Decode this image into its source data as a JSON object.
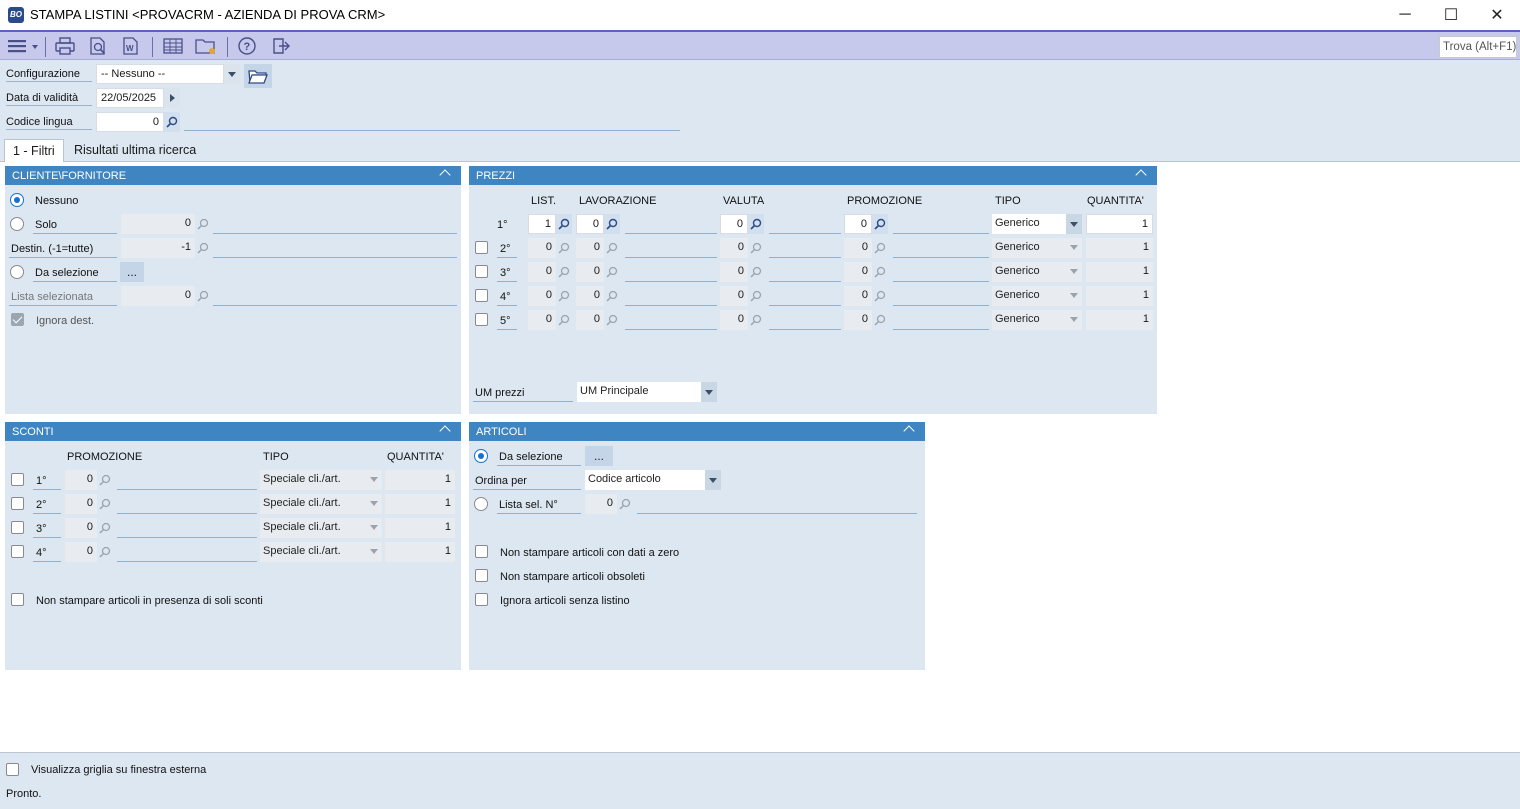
{
  "window": {
    "app_icon": "BO",
    "title": "STAMPA LISTINI <PROVACRM - AZIENDA DI PROVA CRM>",
    "controls": {
      "minimize": "─",
      "maximize": "☐",
      "close": "✕"
    }
  },
  "toolbar": {
    "icons": [
      "menu-icon",
      "printer-icon",
      "print-preview-icon",
      "word-export-icon",
      "grid-icon",
      "folder-settings-icon",
      "help-icon",
      "exit-icon"
    ],
    "search_placeholder": "Trova (Alt+F1)"
  },
  "header": {
    "configurazione": {
      "label": "Configurazione",
      "value": "-- Nessuno --"
    },
    "data_validita": {
      "label": "Data di validità",
      "value": "22/05/2025"
    },
    "codice_lingua": {
      "label": "Codice lingua",
      "value": "0"
    }
  },
  "tabs": [
    {
      "label": "1 - Filtri",
      "active": true
    },
    {
      "label": "Risultati ultima ricerca",
      "active": false
    }
  ],
  "cliente_fornitore": {
    "title": "CLIENTE\\FORNITORE",
    "nessuno": "Nessuno",
    "solo": "Solo",
    "solo_value": "0",
    "destin": "Destin. (-1=tutte)",
    "destin_value": "-1",
    "da_selezione": "Da selezione",
    "da_selezione_btn": "...",
    "lista_selezionata": "Lista selezionata",
    "lista_value": "0",
    "ignora_dest": "Ignora dest."
  },
  "prezzi": {
    "title": "PREZZI",
    "columns": {
      "list": "LIST.",
      "lavorazione": "LAVORAZIONE",
      "valuta": "VALUTA",
      "promozione": "PROMOZIONE",
      "tipo": "TIPO",
      "quantita": "QUANTITA'"
    },
    "rows": [
      {
        "label": "1°",
        "list": "1",
        "lav": "0",
        "valuta": "0",
        "promo": "0",
        "tipo": "Generico",
        "qta": "1"
      },
      {
        "label": "2°",
        "list": "0",
        "lav": "0",
        "valuta": "0",
        "promo": "0",
        "tipo": "Generico",
        "qta": "1"
      },
      {
        "label": "3°",
        "list": "0",
        "lav": "0",
        "valuta": "0",
        "promo": "0",
        "tipo": "Generico",
        "qta": "1"
      },
      {
        "label": "4°",
        "list": "0",
        "lav": "0",
        "valuta": "0",
        "promo": "0",
        "tipo": "Generico",
        "qta": "1"
      },
      {
        "label": "5°",
        "list": "0",
        "lav": "0",
        "valuta": "0",
        "promo": "0",
        "tipo": "Generico",
        "qta": "1"
      }
    ],
    "um_label": "UM prezzi",
    "um_value": "UM Principale"
  },
  "sconti": {
    "title": "SCONTI",
    "columns": {
      "promozione": "PROMOZIONE",
      "tipo": "TIPO",
      "quantita": "QUANTITA'"
    },
    "rows": [
      {
        "label": "1°",
        "promo": "0",
        "tipo": "Speciale cli./art.",
        "qta": "1"
      },
      {
        "label": "2°",
        "promo": "0",
        "tipo": "Speciale cli./art.",
        "qta": "1"
      },
      {
        "label": "3°",
        "promo": "0",
        "tipo": "Speciale cli./art.",
        "qta": "1"
      },
      {
        "label": "4°",
        "promo": "0",
        "tipo": "Speciale cli./art.",
        "qta": "1"
      }
    ],
    "non_stampare_sconti": "Non stampare articoli in presenza di soli sconti"
  },
  "articoli": {
    "title": "ARTICOLI",
    "da_selezione": "Da selezione",
    "da_selezione_btn": "...",
    "ordina_per": "Ordina per",
    "ordina_value": "Codice articolo",
    "lista_sel": "Lista sel. N°",
    "lista_value": "0",
    "opt_dati_zero": "Non stampare articoli con dati a zero",
    "opt_obsoleti": "Non stampare articoli obsoleti",
    "opt_senza_listino": "Ignora articoli senza listino"
  },
  "footer": {
    "visualizza": "Visualizza griglia su finestra esterna",
    "status": "Pronto."
  },
  "colors": {
    "toolbar_bg": "#c6c8ec",
    "panel_header": "#3f85c2",
    "panel_bg": "#dde7f1",
    "accent": "#1b6fd1"
  }
}
